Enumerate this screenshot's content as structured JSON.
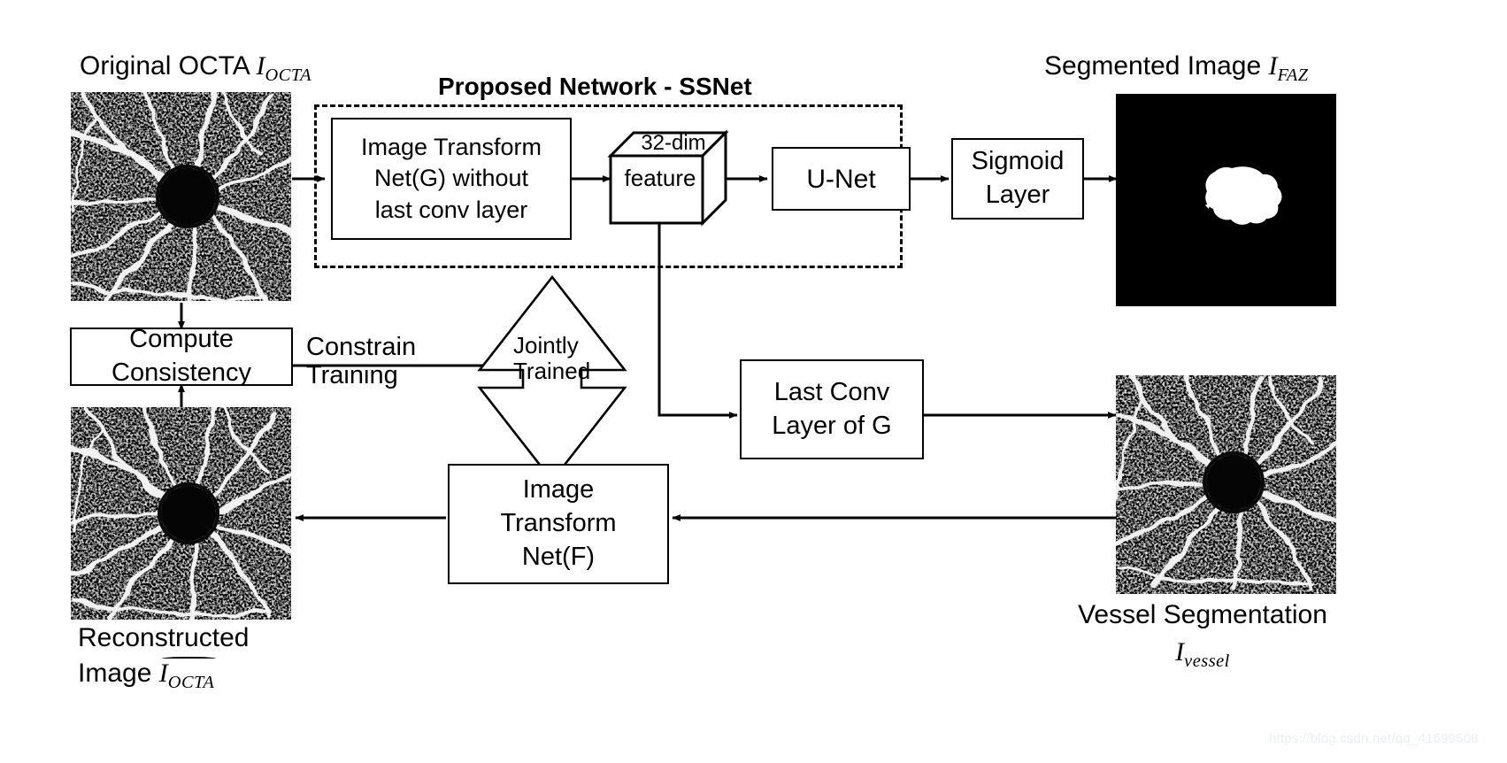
{
  "diagram": {
    "title": "Proposed Network - SSNet",
    "watermark": "https://blog.csdn.net/qq_41699508"
  },
  "labels": {
    "original_octa_text": "Original OCTA ",
    "original_octa_var": "I",
    "original_octa_sub": "OCTA",
    "segmented_image_text": "Segmented Image ",
    "segmented_image_var": "I",
    "segmented_image_sub": "FAZ",
    "reconstructed_line1": "Reconstructed",
    "reconstructed_line2": "Image ",
    "reconstructed_var": "I",
    "reconstructed_sub": "OCTA",
    "vessel_seg_line1": "Vessel Segmentation",
    "vessel_seg_var": "I",
    "vessel_seg_sub": "vessel"
  },
  "nodes": {
    "image_transform_g": {
      "line1": "Image Transform",
      "line2": "Net(G) without",
      "line3": "last conv layer"
    },
    "feature_cube": {
      "top_label": "32-dim",
      "front_label": "feature"
    },
    "unet": {
      "label": "U-Net"
    },
    "sigmoid": {
      "line1": "Sigmoid",
      "line2": "Layer"
    },
    "compute_consistency": {
      "line1": "Compute",
      "line2": "Consistency"
    },
    "last_conv": {
      "line1": "Last Conv",
      "line2": "Layer of G"
    },
    "image_transform_f": {
      "line1": "Image",
      "line2": "Transform",
      "line3": "Net(F)"
    },
    "jointly_trained": {
      "line1": "Jointly",
      "line2": "Trained"
    }
  },
  "edge_labels": {
    "constrain_training_line1": "Constrain",
    "constrain_training_line2": "Training"
  },
  "colors": {
    "stroke": "#000000",
    "background": "#ffffff",
    "image_dark": "#101010",
    "faz_white": "#ffffff",
    "watermark": "#eceff1"
  }
}
